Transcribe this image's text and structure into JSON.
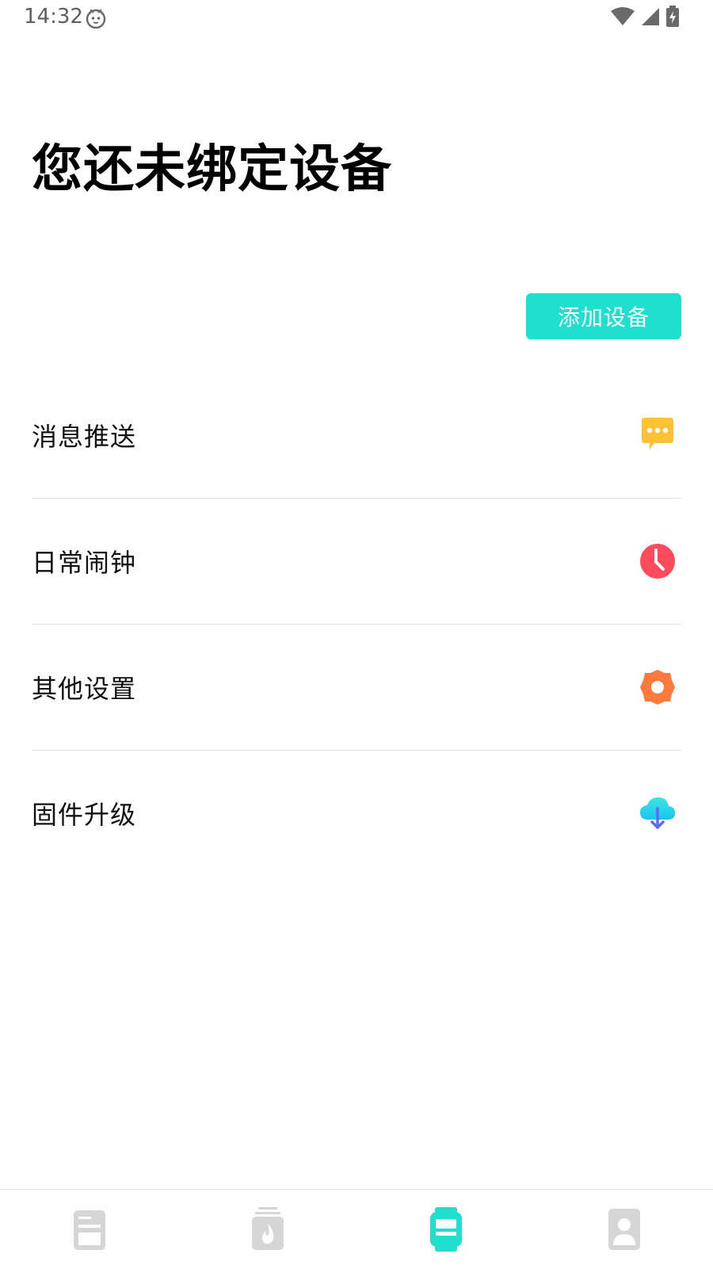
{
  "status_bar": {
    "time": "14:32"
  },
  "header": {
    "title": "您还未绑定设备"
  },
  "actions": {
    "add_device_label": "添加设备"
  },
  "menu": {
    "items": [
      {
        "label": "消息推送",
        "icon": "message-bubble-icon",
        "color": "#ffc233"
      },
      {
        "label": "日常闹钟",
        "icon": "alarm-clock-icon",
        "color": "#ff4b5c"
      },
      {
        "label": "其他设置",
        "icon": "gear-icon",
        "color": "#ff7a3d"
      },
      {
        "label": "固件升级",
        "icon": "cloud-download-icon",
        "color": "#2ad8e8"
      }
    ]
  },
  "bottom_nav": {
    "tabs": [
      {
        "icon": "dashboard-icon",
        "active": false
      },
      {
        "icon": "fire-icon",
        "active": false
      },
      {
        "icon": "watch-icon",
        "active": true
      },
      {
        "icon": "profile-icon",
        "active": false
      }
    ],
    "active_color": "#1fe0cf",
    "inactive_color": "#d6d6d6"
  },
  "colors": {
    "accent": "#1fe0cf"
  }
}
